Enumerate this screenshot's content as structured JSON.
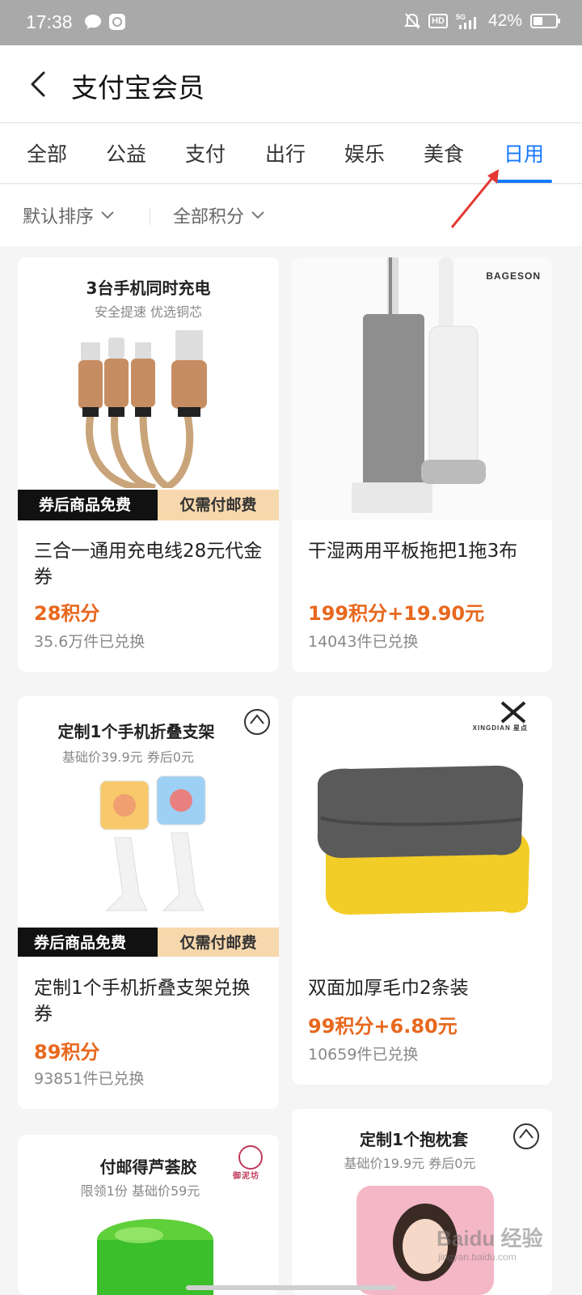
{
  "status_bar": {
    "time": "17:38",
    "network": "5G",
    "hd": "HD",
    "battery_percent": "42%",
    "battery_level": 0.42
  },
  "header": {
    "title": "支付宝会员"
  },
  "tabs": [
    "全部",
    "公益",
    "支付",
    "出行",
    "娱乐",
    "美食",
    "日用"
  ],
  "active_tab": "日用",
  "filters": {
    "sort": "默认排序",
    "points": "全部积分"
  },
  "products": [
    {
      "promo_title": "3台手机同时充电",
      "promo_sub": "安全提速  优选铜芯",
      "banner_left": "券后商品免费",
      "banner_right": "仅需付邮费",
      "name": "三合一通用充电线28元代金券",
      "price": "28积分",
      "count": "35.6万件已兑换"
    },
    {
      "brand": "BAGESON",
      "name": "干湿两用平板拖把1拖3布",
      "price": "199积分+19.90元",
      "count": "14043件已兑换"
    },
    {
      "promo_title": "定制1个手机折叠支架",
      "promo_sub": "基础价39.9元  券后0元",
      "banner_left": "券后商品免费",
      "banner_right": "仅需付邮费",
      "name": "定制1个手机折叠支架兑换券",
      "price": "89积分",
      "count": "93851件已兑换"
    },
    {
      "brand": "XINGDIAN 星点",
      "name": "双面加厚毛巾2条装",
      "price": "99积分+6.80元",
      "count": "10659件已兑换"
    },
    {
      "promo_title": "付邮得芦荟胶",
      "promo_sub": "限领1份  基础价59元",
      "brand": "御泥坊"
    },
    {
      "promo_title": "定制1个抱枕套",
      "promo_sub": "基础价19.9元  券后0元"
    }
  ],
  "watermark": {
    "main": "Baidu 经验",
    "sub": "jingyan.baidu.com"
  },
  "colors": {
    "accent": "#1677ff",
    "price": "#e8681e",
    "status_bar": "#a9a9a9"
  }
}
